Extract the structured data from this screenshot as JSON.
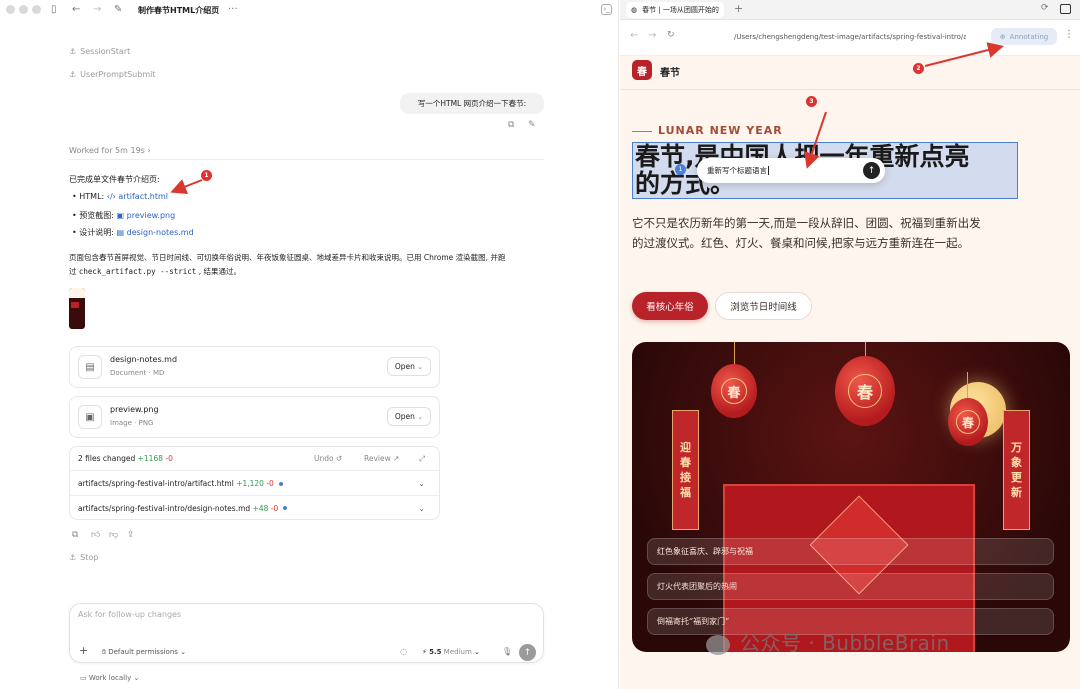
{
  "left": {
    "window_title": "制作春节HTML介绍页",
    "more": "···",
    "hooks": [
      "SessionStart",
      "UserPromptSubmit"
    ],
    "user_message": "写一个HTML 网页介绍一下春节:",
    "worked": "Worked for 5m 19s",
    "response_intro": "已完成单文件春节介绍页:",
    "items": [
      {
        "prefix": "HTML:",
        "icon": "code-icon",
        "link": "artifact.html"
      },
      {
        "prefix": "预览截图:",
        "icon": "image-icon",
        "link": "preview.png"
      },
      {
        "prefix": "设计说明:",
        "icon": "doc-icon",
        "link": "design-notes.md"
      }
    ],
    "summary_line1": "页面包含春节首屏视觉、节日时间线、可切换年俗说明、年夜饭象征圆桌、地域差异卡片和收束说明。已用 Chrome 渲染截图, 并跑",
    "summary_pre": "过",
    "summary_code": "check_artifact.py --strict",
    "summary_post": ", 结果通过。",
    "files": [
      {
        "name": "design-notes.md",
        "meta": "Document · MD",
        "open": "Open",
        "icon": "doc-icon"
      },
      {
        "name": "preview.png",
        "meta": "Image · PNG",
        "open": "Open",
        "icon": "image-icon"
      }
    ],
    "changes": {
      "title": "2 files changed",
      "added": "+1168",
      "removed": "-0",
      "undo": "Undo",
      "review": "Review",
      "rows": [
        {
          "path": "artifacts/spring-festival-intro/artifact.html",
          "added": "+1,120",
          "removed": "-0"
        },
        {
          "path": "artifacts/spring-festival-intro/design-notes.md",
          "added": "+48",
          "removed": "-0"
        }
      ]
    },
    "stop": "Stop",
    "input_placeholder": "Ask for follow-up changes",
    "permissions": "Default permissions",
    "model": "5.5",
    "effort": "Medium",
    "work_locally": "Work locally"
  },
  "right": {
    "tab_title": "春节 | 一场从团圆开始的",
    "url": "/Users/chengshengdeng/test-image/artifacts/spring-festival-intro/ar",
    "annotating": "Annotating",
    "site": {
      "logo": "春",
      "brand": "春节",
      "eyebrow": "LUNAR NEW YEAR",
      "hero_line1": "春节,是中国人把一年重新点亮",
      "hero_line2": "的方式。",
      "popup_text": "重新写个标题语言",
      "popup_badge": "1",
      "lead": "它不只是农历新年的第一天,而是一段从辞旧、团圆、祝福到重新出发的过渡仪式。红色、灯火、餐桌和问候,把家与远方重新连在一起。",
      "btn_primary": "看核心年俗",
      "btn_secondary": "浏览节日时间线",
      "lantern_char": "春",
      "banner_left": [
        "迎",
        "春",
        "接",
        "福"
      ],
      "banner_right": [
        "万",
        "象",
        "更",
        "新"
      ],
      "pills": [
        "红色象征喜庆、辟邪与祝福",
        "灯火代表团聚后的热闹",
        "倒福寄托“福到家门”"
      ]
    }
  },
  "annotations": [
    "1",
    "2",
    "3"
  ],
  "watermark": "公众号 · BubbleBrain"
}
